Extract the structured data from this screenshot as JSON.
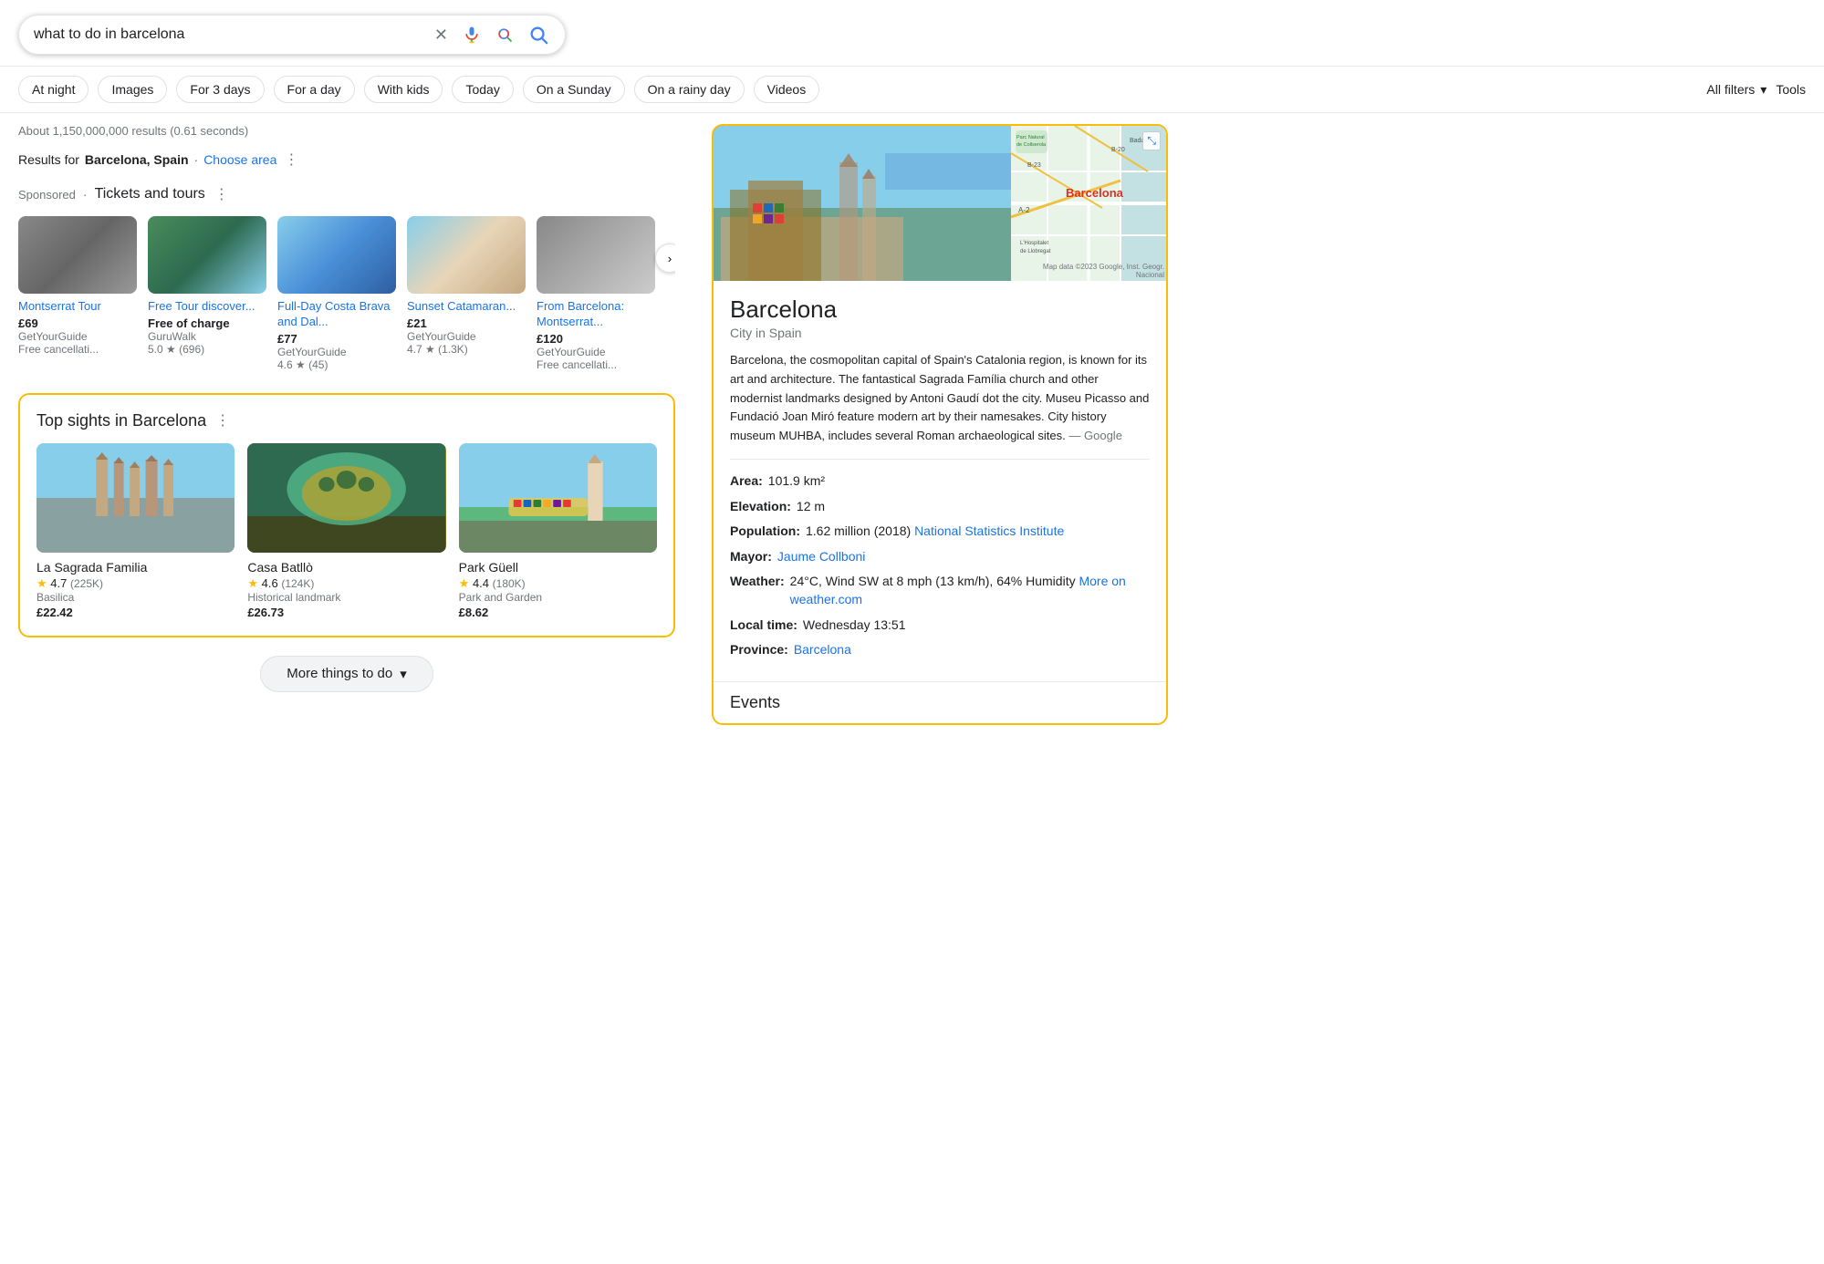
{
  "search": {
    "query": "what to do in barcelona",
    "placeholder": "what to do in barcelona"
  },
  "filter_chips": [
    "At night",
    "Images",
    "For 3 days",
    "For a day",
    "With kids",
    "Today",
    "On a Sunday",
    "On a rainy day",
    "Videos"
  ],
  "all_filters_label": "All filters",
  "tools_label": "Tools",
  "results": {
    "info": "About 1,150,000,000 results (0.61 seconds)",
    "location_prefix": "Results for",
    "location": "Barcelona, Spain",
    "choose_area": "Choose area"
  },
  "sponsored": {
    "label": "Sponsored",
    "title": "Tickets and tours",
    "tours": [
      {
        "title": "Montserrat Tour",
        "price": "£69",
        "provider": "GetYourGuide",
        "note": "Free cancellati...",
        "rating": null,
        "img_class": "t1-img"
      },
      {
        "title": "Free Tour discover...",
        "price": "Free of charge",
        "provider": "GuruWalk",
        "note": "5.0 ★ (696)",
        "rating": "5.0",
        "review_count": "(696)",
        "img_class": "t2-img"
      },
      {
        "title": "Full-Day Costa Brava and Dal...",
        "price": "£77",
        "provider": "GetYourGuide",
        "note": "4.6 ★ (45)",
        "rating": "4.6",
        "review_count": "(45)",
        "img_class": "t3-img"
      },
      {
        "title": "Sunset Catamaran...",
        "price": "£21",
        "provider": "GetYourGuide",
        "note": "4.7 ★ (1.3K)",
        "rating": "4.7",
        "review_count": "(1.3K)",
        "img_class": "t4-img"
      },
      {
        "title": "From Barcelona: Montserrat...",
        "price": "£120",
        "provider": "GetYourGuide",
        "note": "Free cancellati...",
        "rating": null,
        "img_class": "t5-img"
      }
    ]
  },
  "top_sights": {
    "title": "Top sights in Barcelona",
    "sights": [
      {
        "name": "La Sagrada Familia",
        "rating": "4.7",
        "reviews": "225K",
        "type": "Basilica",
        "price": "£22.42",
        "img_class": "sg-img"
      },
      {
        "name": "Casa Batllò",
        "rating": "4.6",
        "reviews": "124K",
        "type": "Historical landmark",
        "price": "£26.73",
        "img_class": "cb-img"
      },
      {
        "name": "Park Güell",
        "rating": "4.4",
        "reviews": "180K",
        "type": "Park and Garden",
        "price": "£8.62",
        "img_class": "pg-img"
      }
    ]
  },
  "more_btn": "More things to do",
  "info_panel": {
    "city": "Barcelona",
    "subtitle": "City in Spain",
    "description": "Barcelona, the cosmopolitan capital of Spain's Catalonia region, is known for its art and architecture. The fantastical Sagrada Família church and other modernist landmarks designed by Antoni Gaudí dot the city. Museu Picasso and Fundació Joan Miró feature modern art by their namesakes. City history museum MUHBA, includes several Roman archaeological sites.",
    "source": "— Google",
    "facts": [
      {
        "label": "Area:",
        "value": "101.9 km²",
        "link": null
      },
      {
        "label": "Elevation:",
        "value": "12 m",
        "link": null
      },
      {
        "label": "Population:",
        "value": "1.62 million (2018)",
        "link": "National Statistics Institute",
        "link_text": "National Statistics Institute"
      },
      {
        "label": "Mayor:",
        "value": "",
        "link": "Jaume Collboni",
        "link_text": "Jaume Collboni"
      },
      {
        "label": "Weather:",
        "value": "24°C, Wind SW at 8 mph (13 km/h), 64% Humidity",
        "link": "More on weather.com",
        "link_text": "More on weather.com"
      },
      {
        "label": "Local time:",
        "value": "Wednesday 13:51",
        "link": null
      },
      {
        "label": "Province:",
        "value": "",
        "link": "Barcelona",
        "link_text": "Barcelona"
      }
    ],
    "map_copyright": "Map data ©2023 Google, Inst. Geogr. Nacional",
    "map_label": "Barcelona",
    "parc_label": "Parc Natural de Collserola",
    "hospital_label": "L'Hospitalet de Llobregat"
  },
  "events": {
    "title": "Events"
  }
}
